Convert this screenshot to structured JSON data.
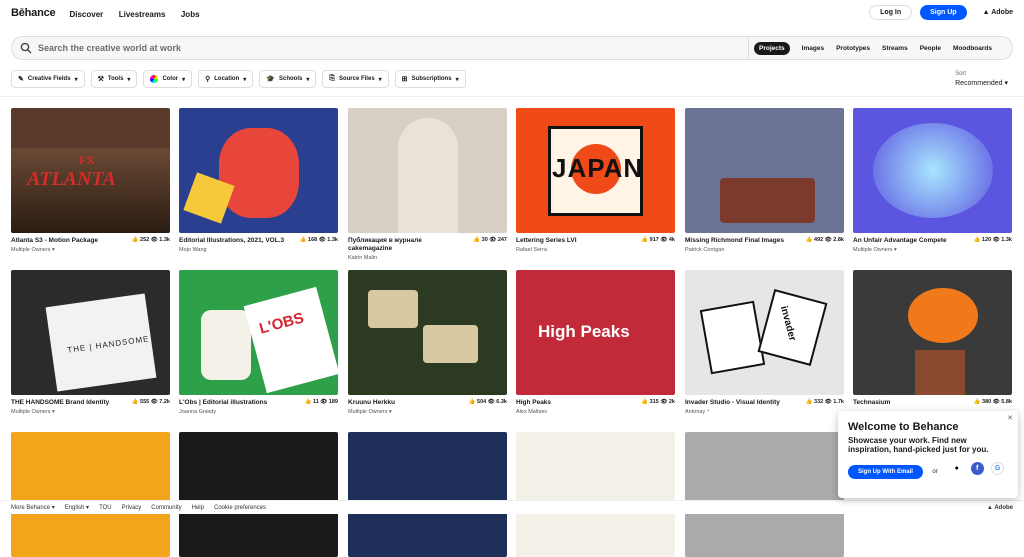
{
  "header": {
    "logo": "Bēhance",
    "nav": [
      "Discover",
      "Livestreams",
      "Jobs"
    ],
    "login": "Log In",
    "signup": "Sign Up",
    "adobe": "Adobe"
  },
  "search": {
    "placeholder": "Search the creative world at work",
    "tabs": [
      "Projects",
      "Images",
      "Prototypes",
      "Streams",
      "People",
      "Moodboards"
    ],
    "active_tab": "Projects"
  },
  "filters": [
    {
      "label": "Creative Fields",
      "icon": "fields-icon"
    },
    {
      "label": "Tools",
      "icon": "tools-icon"
    },
    {
      "label": "Color",
      "icon": "color-wheel-icon"
    },
    {
      "label": "Location",
      "icon": "location-icon"
    },
    {
      "label": "Schools",
      "icon": "school-icon"
    },
    {
      "label": "Source Files",
      "icon": "file-icon"
    },
    {
      "label": "Subscriptions",
      "icon": "subscriptions-icon"
    }
  ],
  "sort": {
    "label": "Sort",
    "value": "Recommended"
  },
  "projects": [
    {
      "title": "Atlanta S3 - Motion Package",
      "owner": "Multiple Owners ▾",
      "likes": "252",
      "views": "1.3k",
      "bg": "#5a3a2a"
    },
    {
      "title": "Editorial Illustrations, 2021, VOL.3",
      "owner": "Mojo Wang",
      "likes": "168",
      "views": "1.3k",
      "bg": "#2a3f8f"
    },
    {
      "title": "Публикация в журнале cakemagazine",
      "owner": "Katrin Malin",
      "likes": "30",
      "views": "247",
      "bg": "#d8cfc4"
    },
    {
      "title": "Lettering Series LVI",
      "owner": "Rafael Serra",
      "likes": "917",
      "views": "4k",
      "bg": "#f04a18"
    },
    {
      "title": "Missing Richmond Final Images",
      "owner": "Patrick Corrigan",
      "likes": "492",
      "views": "2.8k",
      "bg": "#6b7396"
    },
    {
      "title": "An Unfair Advantage Compete",
      "owner": "Multiple Owners ▾",
      "likes": "120",
      "views": "1.3k",
      "bg": "#5b55e0"
    },
    {
      "title": "THE HANDSOME Brand Identity",
      "owner": "Multiple Owners ▾",
      "likes": "555",
      "views": "7.2k",
      "bg": "#2b2b2b"
    },
    {
      "title": "L'Obs | Editorial illustrations",
      "owner": "Joanna Gniady",
      "likes": "11",
      "views": "189",
      "bg": "#2fa04a"
    },
    {
      "title": "Kruunu Herkku",
      "owner": "Multiple Owners ▾",
      "likes": "504",
      "views": "6.3k",
      "bg": "#2c3a22"
    },
    {
      "title": "High Peaks",
      "owner": "Alex Maltsev",
      "likes": "315",
      "views": "2k",
      "bg": "#c22a3a"
    },
    {
      "title": "Invader Studio - Visual Identity",
      "owner": "Antonay ⁴",
      "likes": "332",
      "views": "1.7k",
      "bg": "#e6e6e6"
    },
    {
      "title": "Technasium",
      "owner": "",
      "likes": "380",
      "views": "5.8k",
      "bg": "#3a3a3a"
    },
    {
      "title": "",
      "owner": "",
      "likes": "",
      "views": "",
      "bg": "#f2a51b"
    },
    {
      "title": "",
      "owner": "",
      "likes": "",
      "views": "",
      "bg": "#1a1a1a"
    },
    {
      "title": "",
      "owner": "",
      "likes": "",
      "views": "",
      "bg": "#1e2f5a"
    },
    {
      "title": "",
      "owner": "",
      "likes": "",
      "views": "",
      "bg": "#f4f1e8"
    },
    {
      "title": "",
      "owner": "",
      "likes": "",
      "views": "",
      "bg": "#aaaaaa"
    },
    {
      "title": "",
      "owner": "",
      "likes": "",
      "views": "",
      "bg": "#ffffff"
    }
  ],
  "thumb_text": {
    "atlanta": "ATLANTA",
    "fx": "FX",
    "japan": "JAPAN",
    "highpeaks": "High Peaks",
    "lobs": "L'OBS",
    "handsome": "THE | HANDSOME",
    "invader": "invader"
  },
  "footer": [
    "More Behance ▾",
    "English ▾",
    "TOU",
    "Privacy",
    "Community",
    "Help",
    "Cookie preferences"
  ],
  "footer_adobe": "Adobe",
  "popup": {
    "title": "Welcome to Behance",
    "body": "Showcase your work. Find new inspiration, hand-picked just for you.",
    "button": "Sign Up With Email",
    "or": "or"
  }
}
